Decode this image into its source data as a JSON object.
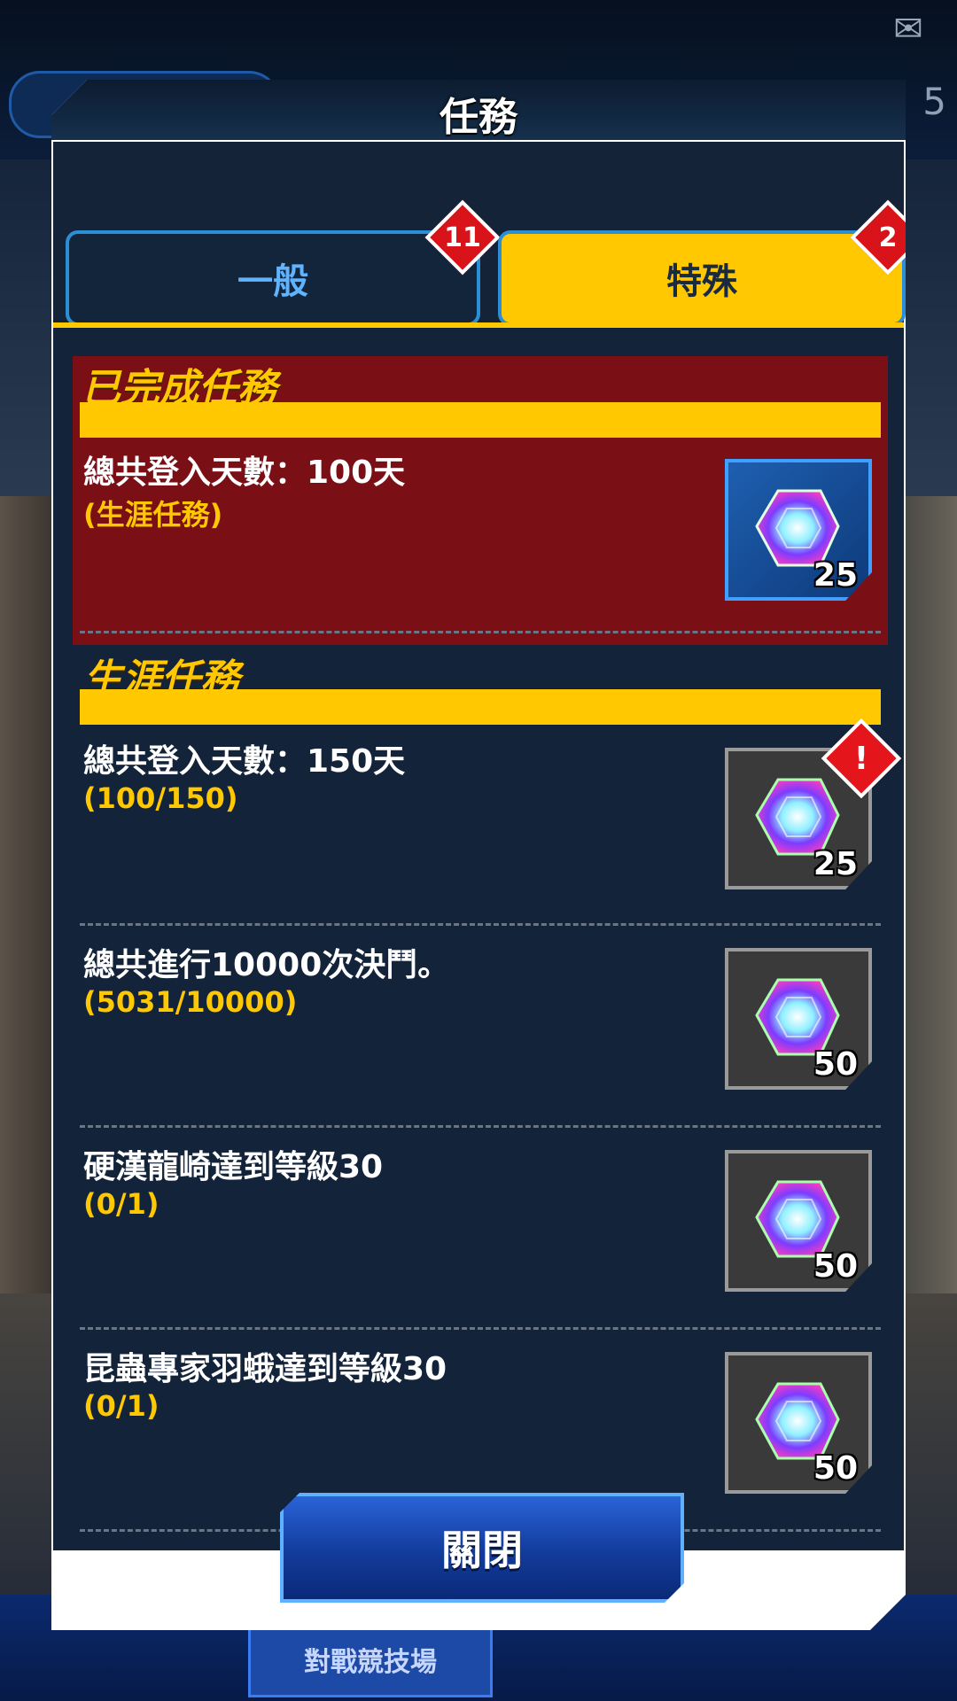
{
  "background": {
    "arena_label": "對戰競技場",
    "top_number": "5"
  },
  "modal": {
    "title": "任務",
    "tabs": [
      {
        "label": "一般",
        "badge": "11",
        "selected": false
      },
      {
        "label": "特殊",
        "badge": "2",
        "selected": true
      }
    ],
    "completed_section": {
      "title": "已完成任務",
      "mission": {
        "title": "總共登入天數：100天",
        "progress": "(生涯任務)",
        "reward_count": "25",
        "reward_icon": "rainbow-gem-icon"
      }
    },
    "career_section": {
      "title": "生涯任務",
      "missions": [
        {
          "title": "總共登入天數：150天",
          "progress": "(100/150)",
          "reward_count": "25",
          "alert": "!"
        },
        {
          "title": "總共進行10000次決鬥。",
          "progress": "(5031/10000)",
          "reward_count": "50"
        },
        {
          "title": "硬漢龍崎達到等級30",
          "progress": "(0/1)",
          "reward_count": "50"
        },
        {
          "title": "昆蟲專家羽蛾達到等級30",
          "progress": "(0/1)",
          "reward_count": "50"
        }
      ]
    },
    "close_label": "關閉"
  },
  "colors": {
    "accent_yellow": "#ffc800",
    "completed_bg": "#7a1015",
    "panel_bg": "#13233a",
    "tab_blue": "#5fb3ff",
    "badge_red": "#d8141a"
  }
}
